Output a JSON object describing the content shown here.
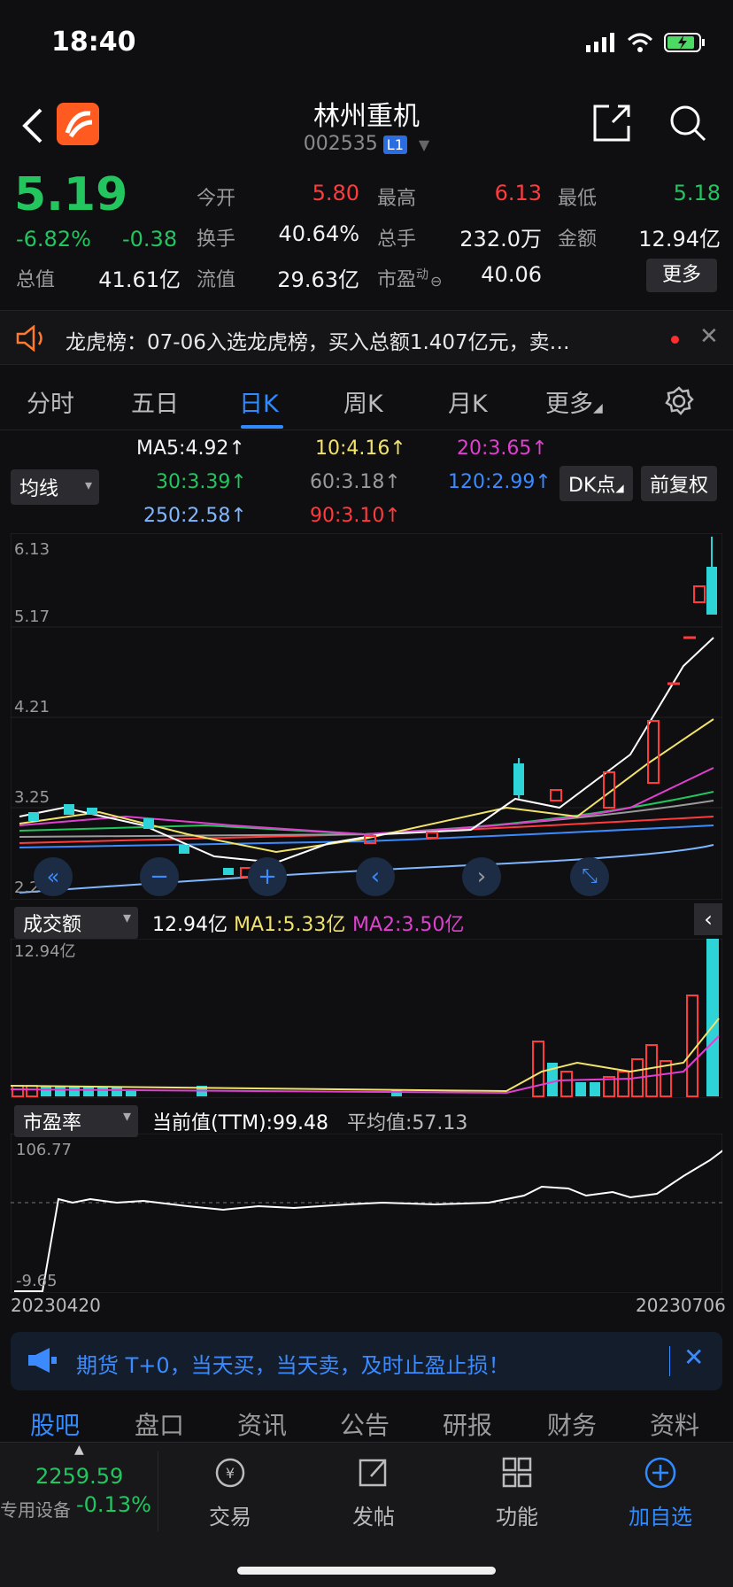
{
  "status": {
    "time": "18:40"
  },
  "header": {
    "title": "林州重机",
    "code": "002535",
    "badge": "L1"
  },
  "quote": {
    "price": "5.19",
    "change_pct": "-6.82%",
    "change": "-0.38",
    "fields": [
      {
        "label": "今开",
        "value": "5.80",
        "tone": "red"
      },
      {
        "label": "最高",
        "value": "6.13",
        "tone": "red"
      },
      {
        "label": "最低",
        "value": "5.18",
        "tone": "green"
      },
      {
        "label": "换手",
        "value": "40.64%",
        "tone": "white"
      },
      {
        "label": "总手",
        "value": "232.0万",
        "tone": "white"
      },
      {
        "label": "金额",
        "value": "12.94亿",
        "tone": "white"
      },
      {
        "label": "总值",
        "value": "41.61亿",
        "tone": "white"
      },
      {
        "label": "流值",
        "value": "29.63亿",
        "tone": "white"
      },
      {
        "label": "市盈",
        "value": "40.06",
        "tone": "white"
      }
    ],
    "pe_sup": "动",
    "more": "更多"
  },
  "news": {
    "text": "龙虎榜：07-06入选龙虎榜，买入总额1.407亿元，卖…"
  },
  "tabs": [
    "分时",
    "五日",
    "日K",
    "周K",
    "月K",
    "更多"
  ],
  "ma_legend": {
    "selector": "均线",
    "items": [
      {
        "text": "MA5:4.92",
        "color": "#f2f2f2"
      },
      {
        "text": "10:4.16",
        "color": "#f2e36a"
      },
      {
        "text": "20:3.65",
        "color": "#e040d0"
      },
      {
        "text": "30:3.39",
        "color": "#22c55e"
      },
      {
        "text": "60:3.18",
        "color": "#9a9a9a"
      },
      {
        "text": "120:2.99",
        "color": "#3b8bff"
      },
      {
        "text": "250:2.58",
        "color": "#7fb8ff"
      },
      {
        "text": "90:3.10",
        "color": "#ff3b3b"
      }
    ],
    "dk_button": "DK点",
    "adjust_button": "前复权"
  },
  "kline": {
    "y_labels": [
      "6.13",
      "5.17",
      "4.21",
      "3.25",
      "2.28"
    ]
  },
  "volume": {
    "selector": "成交额",
    "value": "12.94亿",
    "ma1": "MA1:5.33亿",
    "ma2": "MA2:3.50亿",
    "max_label": "12.94亿"
  },
  "pe": {
    "selector": "市盈率",
    "current": "当前值(TTM):99.48",
    "avg": "平均值:57.13",
    "max_label": "106.77",
    "min_label": "-9.65",
    "start_date": "20230420",
    "end_date": "20230706"
  },
  "promo": {
    "text": "期货 T+0，当天买，当天卖，及时止盈止损！"
  },
  "subtabs": [
    "股吧",
    "盘口",
    "资讯",
    "公告",
    "研报",
    "财务",
    "资料"
  ],
  "bottom": {
    "index_price": "2259.59",
    "index_name": "专用设备",
    "index_change": "-0.13%",
    "nav": [
      "交易",
      "发帖",
      "功能",
      "加自选"
    ]
  }
}
